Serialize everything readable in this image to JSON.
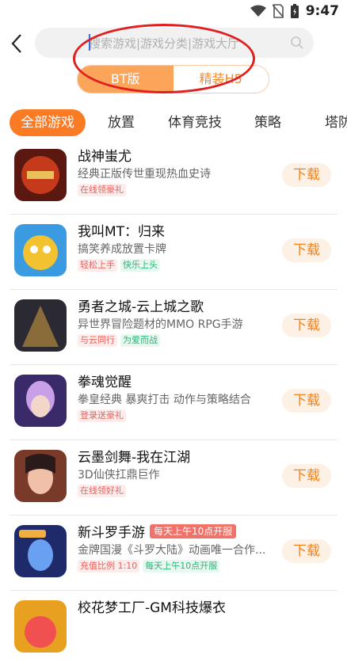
{
  "status": {
    "time": "9:47"
  },
  "search": {
    "placeholder": "搜索游戏|游戏分类|游戏大厅"
  },
  "segment": {
    "options": [
      "BT版",
      "精装H5"
    ]
  },
  "categories": [
    "全部游戏",
    "放置",
    "体育竞技",
    "策略",
    "塔防"
  ],
  "games": [
    {
      "title": "战神蚩尤",
      "desc": "经典正版传世重现热血史诗",
      "tags": [
        {
          "text": "在线领豪礼",
          "style": "red"
        }
      ],
      "download": "下载",
      "palette": [
        "#5a1810",
        "#c63a1c"
      ]
    },
    {
      "title": "我叫MT：归来",
      "desc": "搞笑养成放置卡牌",
      "tags": [
        {
          "text": "轻松上手",
          "style": "red"
        },
        {
          "text": "快乐上头",
          "style": "green"
        }
      ],
      "download": "下载",
      "palette": [
        "#3b9be0",
        "#f2c230"
      ]
    },
    {
      "title": "勇者之城-云上城之歌",
      "desc": "异世界冒险题材的MMO RPG手游",
      "tags": [
        {
          "text": "与云同行",
          "style": "red"
        },
        {
          "text": "为爱而战",
          "style": "green"
        }
      ],
      "download": "下载",
      "palette": [
        "#2b2a33",
        "#8a6c3a"
      ]
    },
    {
      "title": "拳魂觉醒",
      "desc": "拳皇经典 暴爽打击 动作与策略结合",
      "tags": [
        {
          "text": "登录送豪礼",
          "style": "red"
        }
      ],
      "download": "下载",
      "palette": [
        "#3a2a6a",
        "#c8a0e8"
      ]
    },
    {
      "title": "云墨剑舞-我在江湖",
      "desc": "3D仙侠扛鼎巨作",
      "tags": [
        {
          "text": "在线领好礼",
          "style": "red"
        }
      ],
      "download": "下载",
      "palette": [
        "#7a3a2a",
        "#f0c0a8"
      ]
    },
    {
      "title": "新斗罗手游",
      "badge": "每天上午10点开服",
      "desc": "金牌国漫《斗罗大陆》动画唯一合作...",
      "tags": [
        {
          "text": "充值比例 1:10",
          "style": "red"
        },
        {
          "text": "每天上午10点开服",
          "style": "green"
        }
      ],
      "download": "下载",
      "palette": [
        "#1e2a6a",
        "#6aa0f0"
      ]
    },
    {
      "title": "校花梦工厂-GM科技爆衣",
      "desc": "",
      "tags": [],
      "download": "",
      "palette": [
        "#e8a020",
        "#f05050"
      ]
    }
  ],
  "colors": {
    "accent": "#fb7a24",
    "download_bg": "#fdf0e4",
    "annotation": "#e02020"
  }
}
